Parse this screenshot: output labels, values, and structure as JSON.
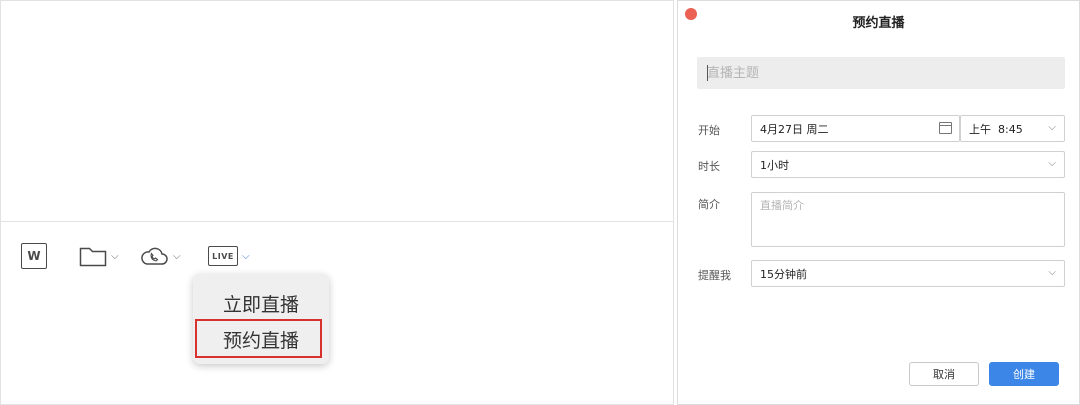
{
  "left_panel": {
    "toolbar": {
      "word_label": "W",
      "live_label": "LIVE"
    },
    "live_menu": {
      "items": [
        {
          "label": "立即直播"
        },
        {
          "label": "预约直播"
        }
      ]
    }
  },
  "dialog": {
    "title": "预约直播",
    "topic": {
      "placeholder": "直播主题",
      "value": ""
    },
    "start": {
      "label": "开始",
      "date": "4月27日 周二",
      "time": "上午  8:45"
    },
    "duration": {
      "label": "时长",
      "value": "1小时"
    },
    "intro": {
      "label": "简介",
      "placeholder": "直播简介"
    },
    "reminder": {
      "label": "提醒我",
      "value": "15分钟前"
    },
    "cancel_label": "取消",
    "create_label": "创建"
  },
  "colors": {
    "accent": "#3b86e6",
    "highlight": "#d8302d",
    "close": "#ec5f53"
  }
}
